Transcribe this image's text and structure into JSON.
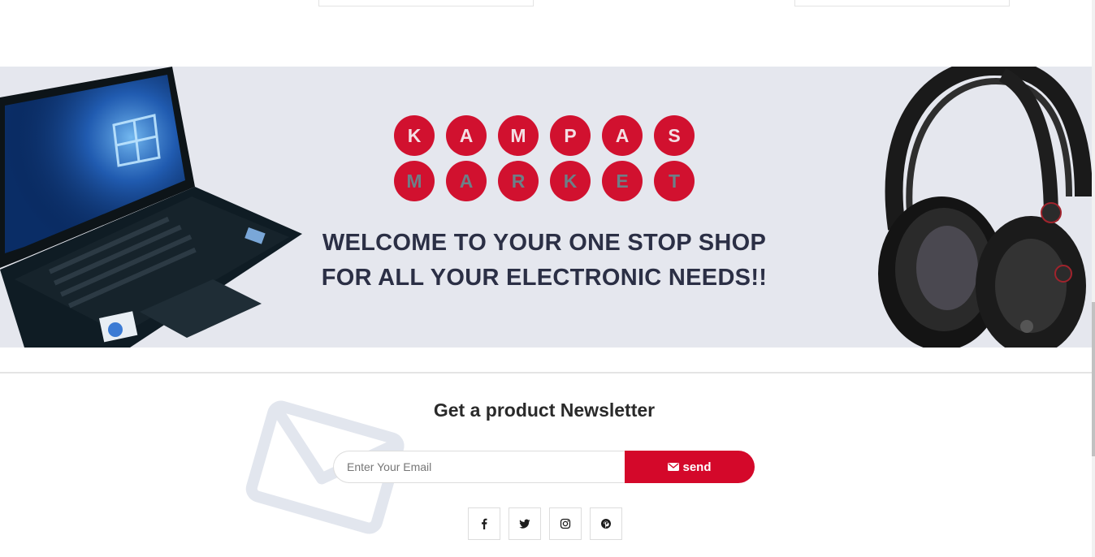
{
  "banner": {
    "letters_row1": [
      "K",
      "A",
      "M",
      "P",
      "A",
      "S"
    ],
    "letters_row2": [
      "M",
      "A",
      "R",
      "K",
      "E",
      "T"
    ],
    "welcome_line1": "WELCOME TO YOUR ONE STOP SHOP",
    "welcome_line2": "FOR ALL YOUR ELECTRONIC NEEDS!!",
    "colors": {
      "background": "#e5e7ee",
      "circle": "#d1112f",
      "heading": "#2b2f45"
    }
  },
  "newsletter": {
    "title_prefix": "Get a product",
    "title_bold": "Newsletter",
    "email_placeholder": "Enter Your Email",
    "send_label": "send",
    "send_icon": "envelope-icon",
    "accent": "#d4082a"
  },
  "socials": [
    {
      "name": "facebook-icon"
    },
    {
      "name": "twitter-icon"
    },
    {
      "name": "instagram-icon"
    },
    {
      "name": "pinterest-icon"
    }
  ]
}
